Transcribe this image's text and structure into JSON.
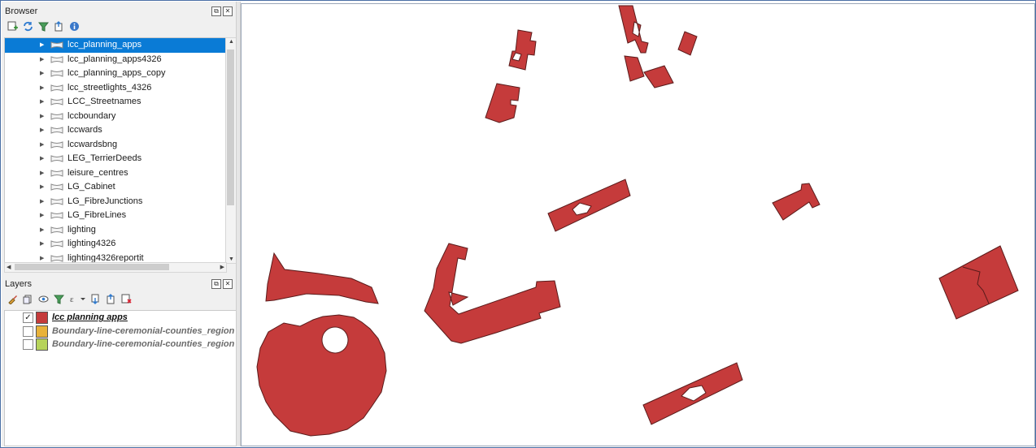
{
  "browser": {
    "title": "Browser",
    "dock_float": "⧉",
    "dock_close": "✕",
    "items": [
      {
        "label": "lcc_planning_apps",
        "selected": true
      },
      {
        "label": "lcc_planning_apps4326"
      },
      {
        "label": "lcc_planning_apps_copy"
      },
      {
        "label": "lcc_streetlights_4326"
      },
      {
        "label": "LCC_Streetnames"
      },
      {
        "label": "lccboundary"
      },
      {
        "label": "lccwards"
      },
      {
        "label": "lccwardsbng"
      },
      {
        "label": "LEG_TerrierDeeds"
      },
      {
        "label": "leisure_centres"
      },
      {
        "label": "LG_Cabinet"
      },
      {
        "label": "LG_FibreJunctions"
      },
      {
        "label": "LG_FibreLines"
      },
      {
        "label": "lighting"
      },
      {
        "label": "lighting4326"
      },
      {
        "label": "lighting4326reportit"
      }
    ]
  },
  "layers": {
    "title": "Layers",
    "dock_float": "⧉",
    "dock_close": "✕",
    "items": [
      {
        "label": "lcc planning apps",
        "checked": true,
        "check_mark": "✓",
        "color": "#c53b3b",
        "active": true
      },
      {
        "label": "Boundary-line-ceremonial-counties_region",
        "checked": false,
        "check_mark": "",
        "color": "#e8b23a"
      },
      {
        "label": "Boundary-line-ceremonial-counties_region",
        "checked": false,
        "check_mark": "",
        "color": "#b6d35a"
      }
    ]
  },
  "colors": {
    "feature_fill": "#c53b3b",
    "feature_stroke": "#5a1b1b",
    "selection": "#0a7bd6"
  }
}
